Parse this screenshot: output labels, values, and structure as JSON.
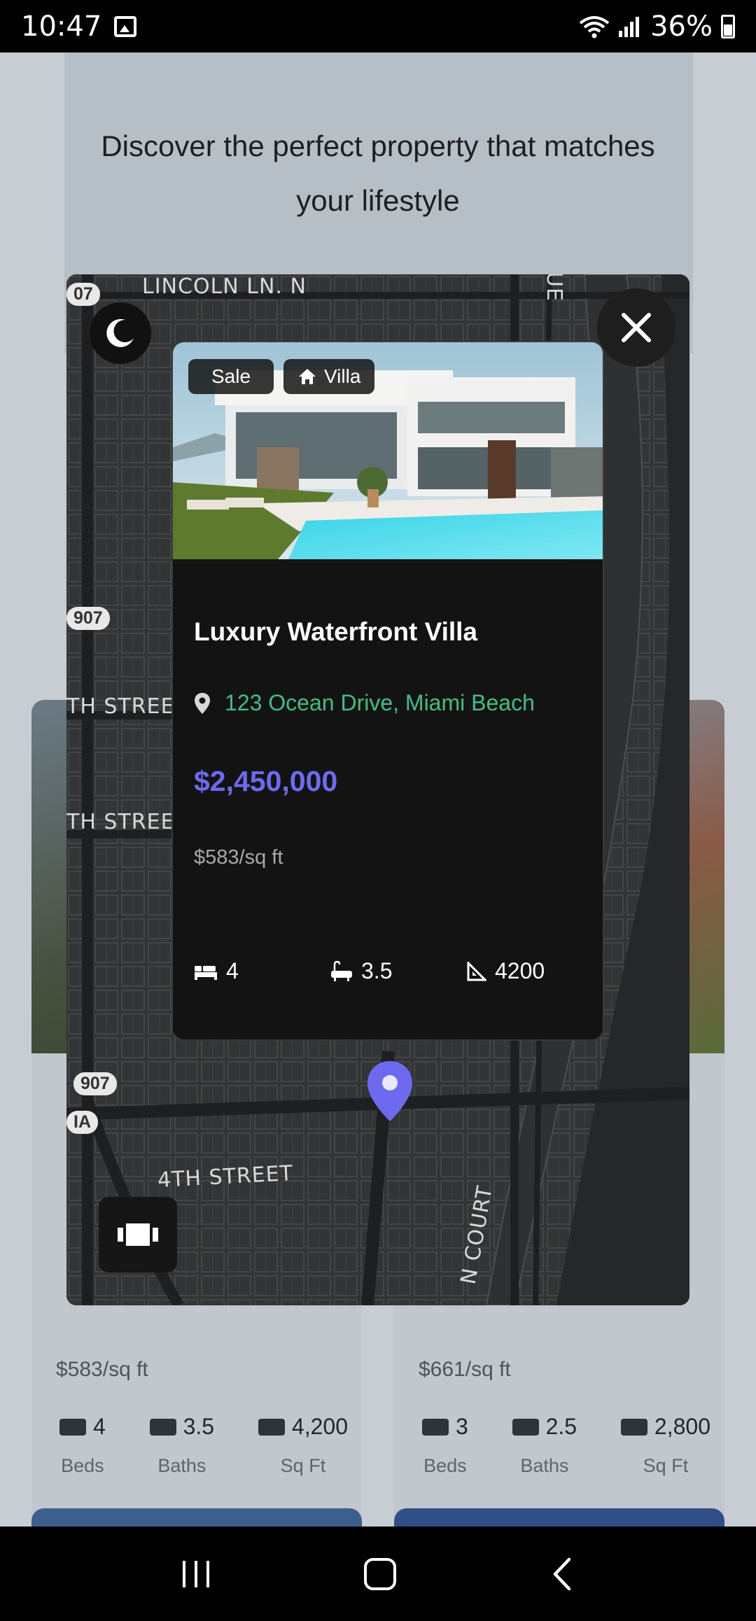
{
  "status_bar": {
    "time": "10:47",
    "battery": "36%"
  },
  "background": {
    "tagline": "Discover the perfect property that matches your lifestyle",
    "cards": [
      {
        "price_per_sqft": "$583/sq ft",
        "stats": [
          {
            "value": "4",
            "label": "Beds"
          },
          {
            "value": "3.5",
            "label": "Baths"
          },
          {
            "value": "4,200",
            "label": "Sq Ft"
          }
        ]
      },
      {
        "price_per_sqft": "$661/sq ft",
        "stats": [
          {
            "value": "3",
            "label": "Beds"
          },
          {
            "value": "2.5",
            "label": "Baths"
          },
          {
            "value": "2,800",
            "label": "Sq Ft"
          }
        ]
      }
    ]
  },
  "map": {
    "labels": {
      "lincoln": "LINCOLN LN. N",
      "street_a": "TH STREET",
      "street_b": "TH STREET",
      "fourth": "4TH STREET",
      "court": "N COURT",
      "ue": "UE"
    },
    "shields": {
      "s1": "07",
      "s2": "907",
      "s3": "907",
      "s4": "IA"
    },
    "accent_color": "#6e6af0"
  },
  "popup": {
    "tag_sale": "Sale",
    "tag_type": "Villa",
    "title": "Luxury Waterfront Villa",
    "address": "123 Ocean Drive, Miami Beach",
    "price": "$2,450,000",
    "price_per_sqft": "$583/sq ft",
    "beds": "4",
    "baths": "3.5",
    "sqft": "4200"
  }
}
